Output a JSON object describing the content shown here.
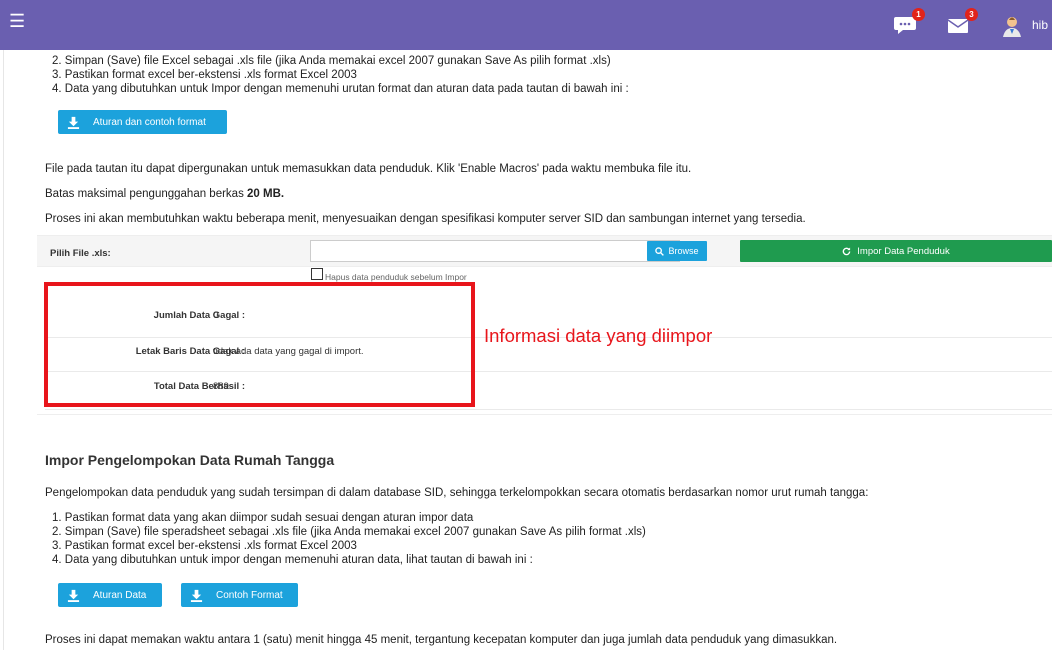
{
  "topbar": {
    "menu_icon": "hamburger-icon",
    "chat_badge": "1",
    "mail_badge": "3",
    "user_name": "hib"
  },
  "upload_instructions": [
    "2. Simpan (Save) file Excel sebagai .xls file (jika Anda memakai excel 2007 gunakan Save As pilih format .xls)",
    "3. Pastikan format excel ber-ekstensi .xls format Excel 2003",
    "4. Data yang dibutuhkan untuk Impor dengan memenuhi urutan format dan aturan data pada tautan di bawah ini :"
  ],
  "format_button_label": "Aturan dan contoh format",
  "para_macros": "File pada tautan itu dapat dipergunakan untuk memasukkan data penduduk. Klik 'Enable Macros' pada waktu membuka file itu.",
  "para_limit_prefix": "Batas maksimal pengunggahan berkas ",
  "para_limit_value": "20 MB.",
  "para_process": "Proses ini akan membutuhkan waktu beberapa menit, menyesuaikan dengan spesifikasi komputer server SID dan sambungan internet yang tersedia.",
  "form": {
    "file_label": "Pilih File .xls:",
    "file_value": "",
    "browse_label": "Browse",
    "impor_label": "Impor Data Penduduk",
    "checkbox_label": "Hapus data penduduk sebelum Impor"
  },
  "results": [
    {
      "label": "Jumlah Data Gagal :",
      "value": "0"
    },
    {
      "label": "Letak Baris Data Gagal :",
      "value": "tidak ada data yang gagal di import."
    },
    {
      "label": "Total Data Berhasil :",
      "value": "889"
    }
  ],
  "annotation": "Informasi data yang diimpor",
  "section2": {
    "title": "Impor Pengelompokan Data Rumah Tangga",
    "intro": "Pengelompokan data penduduk yang sudah tersimpan di dalam database SID, sehingga terkelompokkan secara otomatis berdasarkan nomor urut rumah tangga:",
    "steps": [
      "1. Pastikan format data yang akan diimpor sudah sesuai dengan aturan impor data",
      "2. Simpan (Save) file speradsheet sebagai .xls file (jika Anda memakai excel 2007 gunakan Save As pilih format .xls)",
      "3. Pastikan format excel ber-ekstensi .xls format Excel 2003",
      "4. Data yang dibutuhkan untuk impor dengan memenuhi aturan data, lihat tautan di bawah ini :"
    ],
    "btn_aturan": "Aturan Data",
    "btn_contoh": "Contoh Format",
    "footer": "Proses ini dapat memakan waktu antara 1 (satu) menit hingga 45 menit, tergantung kecepatan komputer dan juga jumlah data penduduk yang dimasukkan."
  },
  "colors": {
    "topbar": "#6a5fb0",
    "info_blue": "#1ca2dc",
    "success_green": "#1f9b4f",
    "annotation_red": "#e8151b"
  }
}
